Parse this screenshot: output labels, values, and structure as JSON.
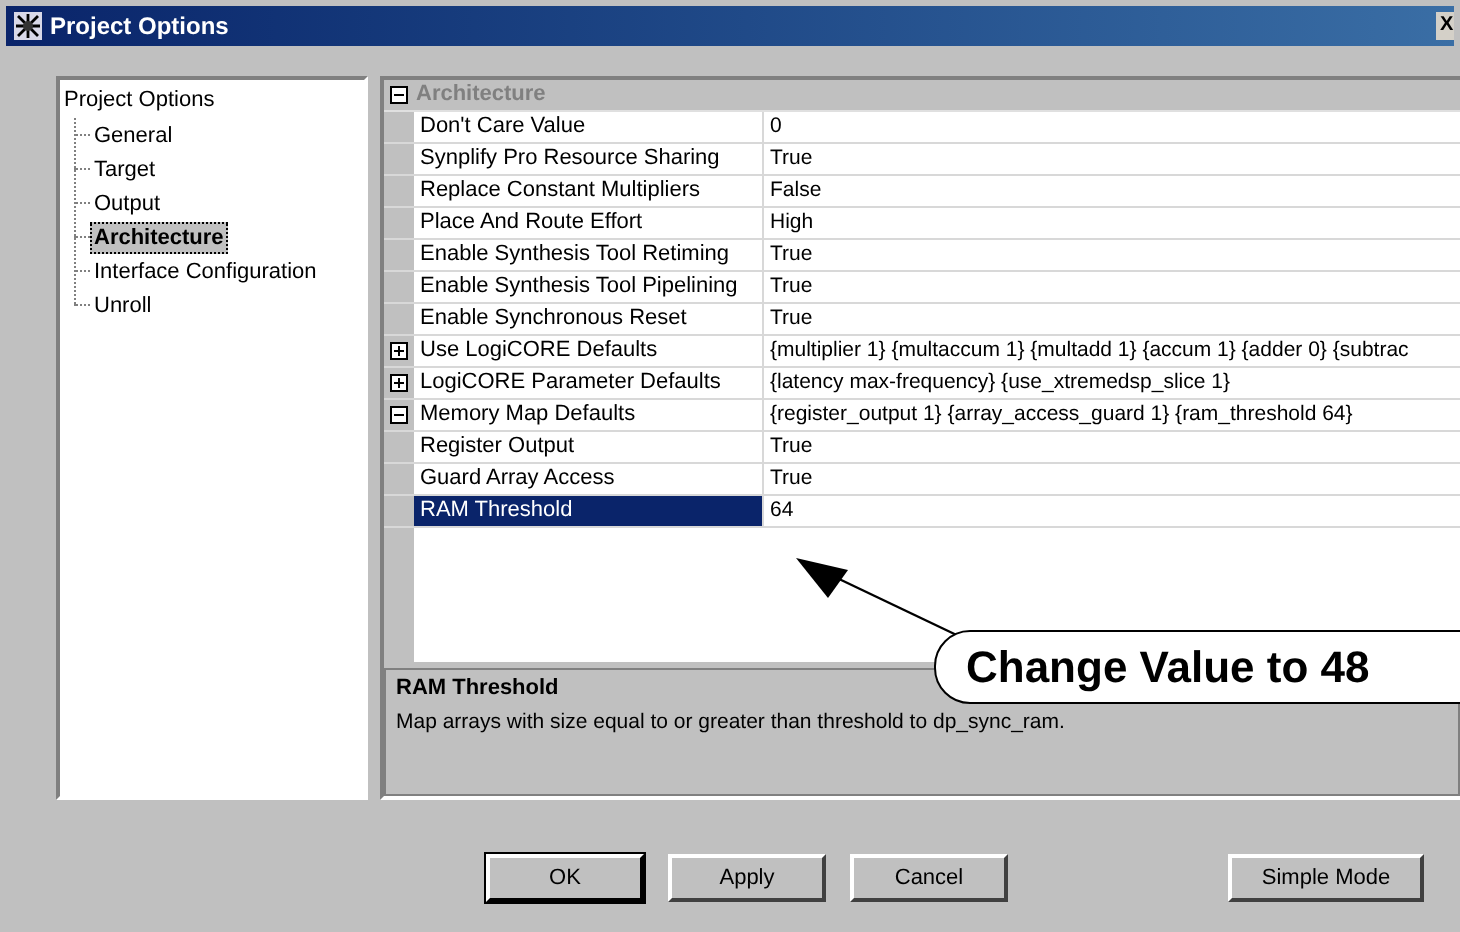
{
  "window": {
    "title": "Project Options",
    "close": "X"
  },
  "tree": {
    "label": "Project Options",
    "children": [
      {
        "label": "General",
        "selected": false
      },
      {
        "label": "Target",
        "selected": false
      },
      {
        "label": "Output",
        "selected": false
      },
      {
        "label": "Architecture",
        "selected": true
      },
      {
        "label": "Interface Configuration",
        "selected": false
      },
      {
        "label": "Unroll",
        "selected": false
      }
    ]
  },
  "grid": {
    "rows": [
      {
        "kind": "group",
        "name": "Architecture",
        "expanded": true,
        "selected": false
      },
      {
        "kind": "property",
        "name": "Don't Care Value",
        "value": "0",
        "selected": false
      },
      {
        "kind": "property",
        "name": "Synplify Pro Resource Sharing",
        "value": "True",
        "selected": false
      },
      {
        "kind": "property",
        "name": "Replace Constant Multipliers",
        "value": "False",
        "selected": false
      },
      {
        "kind": "property",
        "name": "Place And Route Effort",
        "value": "High",
        "selected": false
      },
      {
        "kind": "property",
        "name": "Enable Synthesis Tool Retiming",
        "value": "True",
        "selected": false
      },
      {
        "kind": "property",
        "name": "Enable Synthesis Tool Pipelining",
        "value": "True",
        "selected": false
      },
      {
        "kind": "property",
        "name": "Enable Synchronous Reset",
        "value": "True",
        "selected": false
      },
      {
        "kind": "expandable",
        "name": "Use LogiCORE Defaults",
        "value": "{multiplier 1} {multaccum 1} {multadd 1} {accum 1} {adder 0} {subtrac",
        "expanded": false,
        "selected": false
      },
      {
        "kind": "expandable",
        "name": "LogiCORE Parameter Defaults",
        "value": "{latency max-frequency} {use_xtremedsp_slice 1}",
        "expanded": false,
        "selected": false
      },
      {
        "kind": "expandable",
        "name": "Memory Map Defaults",
        "value": "{register_output 1} {array_access_guard 1} {ram_threshold 64}",
        "expanded": true,
        "selected": false
      },
      {
        "kind": "property",
        "name": "Register Output",
        "value": "True",
        "selected": false
      },
      {
        "kind": "property",
        "name": "Guard Array Access",
        "value": "True",
        "selected": false
      },
      {
        "kind": "property",
        "name": "RAM Threshold",
        "value": "64",
        "selected": true
      }
    ]
  },
  "description": {
    "title": "RAM Threshold",
    "text": "Map arrays with size equal to or greater than threshold to dp_sync_ram."
  },
  "callout": {
    "text": "Change Value to 48"
  },
  "buttons": [
    {
      "label": "OK",
      "default": true
    },
    {
      "label": "Apply",
      "default": false
    },
    {
      "label": "Cancel",
      "default": false
    }
  ],
  "mode_button": {
    "label": "Simple Mode"
  }
}
